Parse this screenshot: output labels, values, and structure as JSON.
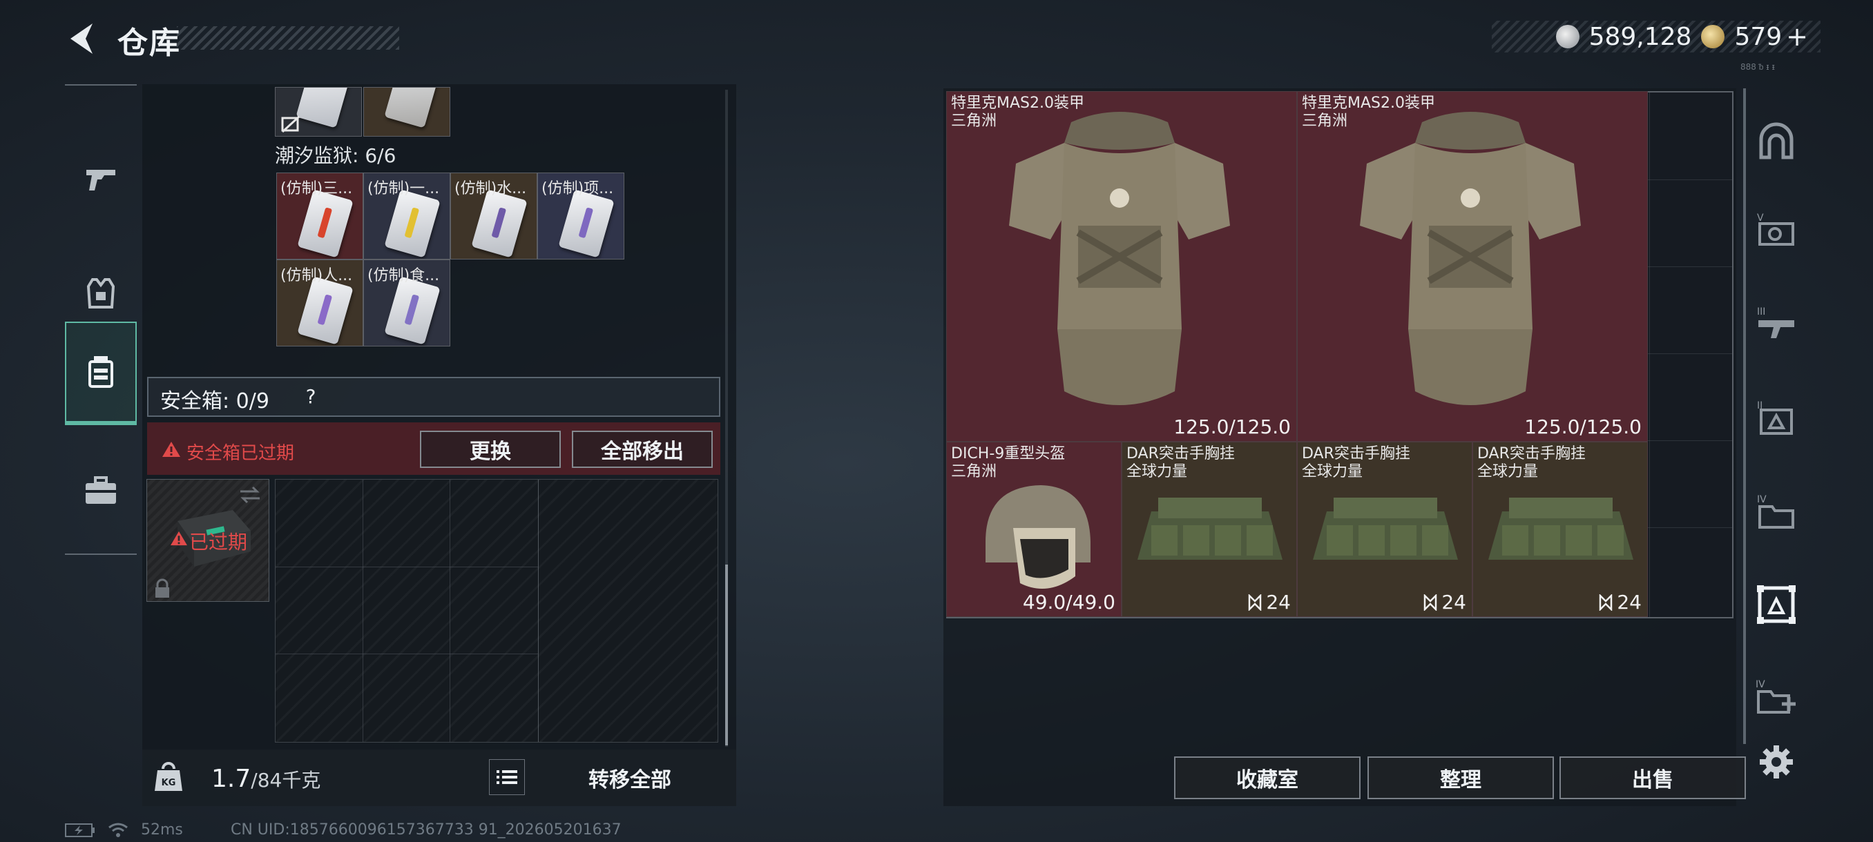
{
  "header": {
    "title": "仓库",
    "currency_primary": "589,128",
    "currency_secondary": "579",
    "currency_plus": "+"
  },
  "left_nav": {
    "items": [
      {
        "name": "weapons",
        "icon": "gun-icon"
      },
      {
        "name": "equipment",
        "icon": "vest-icon"
      },
      {
        "name": "containers",
        "icon": "container-icon",
        "active": true
      },
      {
        "name": "tools",
        "icon": "toolbox-icon"
      }
    ]
  },
  "inventory": {
    "section_label": "潮汐监狱: 6/6",
    "top_partial_cards": [
      {
        "stripe": "#9aa0a8"
      },
      {
        "stripe": "#8a7b6a"
      }
    ],
    "cards": [
      {
        "name": "(仿制)三...",
        "stripe": "#d8442c",
        "bg": "#4e2428"
      },
      {
        "name": "(仿制)一...",
        "stripe": "#e2c032",
        "bg": "#2e3242"
      },
      {
        "name": "(仿制)水...",
        "stripe": "#6e5aa8",
        "bg": "#3e3428"
      },
      {
        "name": "(仿制)项...",
        "stripe": "#7e68c0",
        "bg": "#30344a"
      },
      {
        "name": "(仿制)人...",
        "stripe": "#8a6ac8",
        "bg": "#3e3428"
      },
      {
        "name": "(仿制)食...",
        "stripe": "#8272c4",
        "bg": "#2e3240"
      }
    ]
  },
  "safebox": {
    "label": "安全箱: 0/9",
    "help": "?",
    "expired_warning": "安全箱已过期",
    "replace_button": "更换",
    "move_all_button": "全部移出",
    "expired_badge": "已过期"
  },
  "bottom": {
    "weight_current": "1.7",
    "weight_max": "/84千克",
    "weight_icon_text": "KG",
    "transfer_all_button": "转移全部"
  },
  "stash": {
    "items": [
      {
        "name": "特里克MAS2.0装甲",
        "faction": "三角洲",
        "durability": "125.0/125.0",
        "kind": "armor"
      },
      {
        "name": "特里克MAS2.0装甲",
        "faction": "三角洲",
        "durability": "125.0/125.0",
        "kind": "armor"
      },
      {
        "name": "DICH-9重型头盔",
        "faction": "三角洲",
        "durability": "49.0/49.0",
        "kind": "helmet"
      },
      {
        "name": "DAR突击手胸挂",
        "faction": "全球力量",
        "stack": "24",
        "kind": "rig"
      },
      {
        "name": "DAR突击手胸挂",
        "faction": "全球力量",
        "stack": "24",
        "kind": "rig"
      },
      {
        "name": "DAR突击手胸挂",
        "faction": "全球力量",
        "stack": "24",
        "kind": "rig"
      }
    ],
    "collection_button": "收藏室",
    "sort_button": "整理",
    "sell_button": "出售"
  },
  "right_rail": {
    "items": [
      {
        "name": "home",
        "icon": "arch-icon"
      },
      {
        "name": "stash-5",
        "icon": "stash-v-icon",
        "label": "V"
      },
      {
        "name": "stash-3",
        "icon": "stash-iii-icon",
        "label": "III"
      },
      {
        "name": "stash-2",
        "icon": "stash-ii-icon",
        "label": "II"
      },
      {
        "name": "stash-4",
        "icon": "stash-iv-icon",
        "label": "IV"
      },
      {
        "name": "stash-active",
        "icon": "stash-active-icon",
        "active": true
      },
      {
        "name": "stash-4-add",
        "icon": "stash-add-icon",
        "label": "IV"
      }
    ],
    "corner_text": "888 ᵬ ᵻ ᵻ"
  },
  "status": {
    "ping": "52ms",
    "uid": "CN UID:1857660096157367733 91_202605201637"
  },
  "colors": {
    "accent_teal": "#5fb9a4",
    "warning_red": "#e14a4a",
    "item_red_bg": "#532730",
    "item_brown_bg": "#3d3428"
  }
}
